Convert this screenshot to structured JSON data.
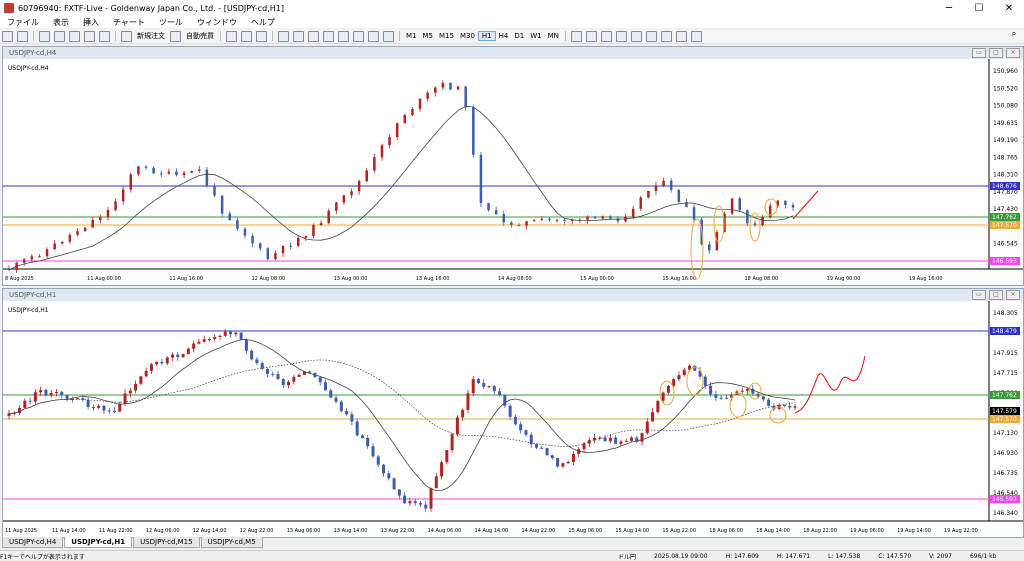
{
  "window": {
    "title": "60796940: FXTF-Live - Goldenway Japan Co., Ltd. - [USDJPY-cd,H1]"
  },
  "menu": [
    "ファイル",
    "表示",
    "挿入",
    "チャート",
    "ツール",
    "ウィンドウ",
    "ヘルプ"
  ],
  "toolbar": {
    "new_order": "新規注文",
    "auto_trade": "自動売買",
    "timeframes": [
      "M1",
      "M5",
      "M15",
      "M30",
      "H1",
      "H4",
      "D1",
      "W1",
      "MN"
    ],
    "active_timeframe": "H1"
  },
  "chart_top": {
    "symbol_label": "USDJPY-cd,H4",
    "window_title": "USDJPY-cd,H4",
    "price_ticks": [
      "150.960",
      "150.520",
      "150.080",
      "149.635",
      "149.190",
      "148.765",
      "148.310",
      "147.870",
      "147.430",
      "146.990",
      "146.545",
      "146.100"
    ],
    "hline_labels": {
      "blue": "148.676",
      "green": "147.762",
      "orange": "147.570",
      "magenta": "146.593"
    },
    "time_ticks": [
      "8 Aug 2025",
      "11 Aug 00:00",
      "11 Aug 16:00",
      "12 Aug 08:00",
      "13 Aug 00:00",
      "13 Aug 16:00",
      "14 Aug 08:00",
      "15 Aug 00:00",
      "15 Aug 16:00",
      "18 Aug 08:00",
      "19 Aug 00:00",
      "19 Aug 16:00"
    ]
  },
  "chart_bottom": {
    "symbol_label": "USDJPY-cd,H1",
    "window_title": "USDJPY-cd,H1",
    "price_ticks": [
      "148.305",
      "148.110",
      "147.915",
      "147.715",
      "147.520",
      "147.325",
      "147.130",
      "146.930",
      "146.735",
      "146.540",
      "146.340"
    ],
    "hline_labels": {
      "blue": "148.479",
      "green": "147.762",
      "gray": "147.579",
      "orange": "147.570",
      "magenta": "146.593"
    },
    "time_ticks": [
      "11 Aug 2025",
      "11 Aug 14:00",
      "11 Aug 22:00",
      "12 Aug 06:00",
      "12 Aug 14:00",
      "12 Aug 22:00",
      "13 Aug 06:00",
      "13 Aug 14:00",
      "13 Aug 22:00",
      "14 Aug 06:00",
      "14 Aug 14:00",
      "14 Aug 22:00",
      "15 Aug 06:00",
      "15 Aug 14:00",
      "15 Aug 22:00",
      "18 Aug 06:00",
      "18 Aug 14:00",
      "18 Aug 22:00",
      "19 Aug 06:00",
      "19 Aug 14:00",
      "19 Aug 22:00"
    ]
  },
  "tabs": [
    "USDJPY-cd,H4",
    "USDJPY-cd,H1",
    "USDJPY-cd,M15",
    "USDJPY-cd,M5"
  ],
  "active_tab": "USDJPY-cd,H1",
  "status": {
    "help": "F1キーでヘルプが表示されます",
    "profile": "ドル円",
    "datetime": "2025.08.19 09:00",
    "open": "H: 147.609",
    "high": "H: 147.671",
    "low": "L: 147.538",
    "close": "C: 147.570",
    "volume": "V: 2097",
    "traffic": "696/1 kb"
  },
  "colors": {
    "bull": "#b22222",
    "bear": "#3b5db0",
    "blue_line": "#3030d0",
    "green_line": "#3a9a3a",
    "orange_line": "#f2a93b",
    "magenta_line": "#ff40ff",
    "ma": "#444444",
    "forecast": "#e02020"
  }
}
